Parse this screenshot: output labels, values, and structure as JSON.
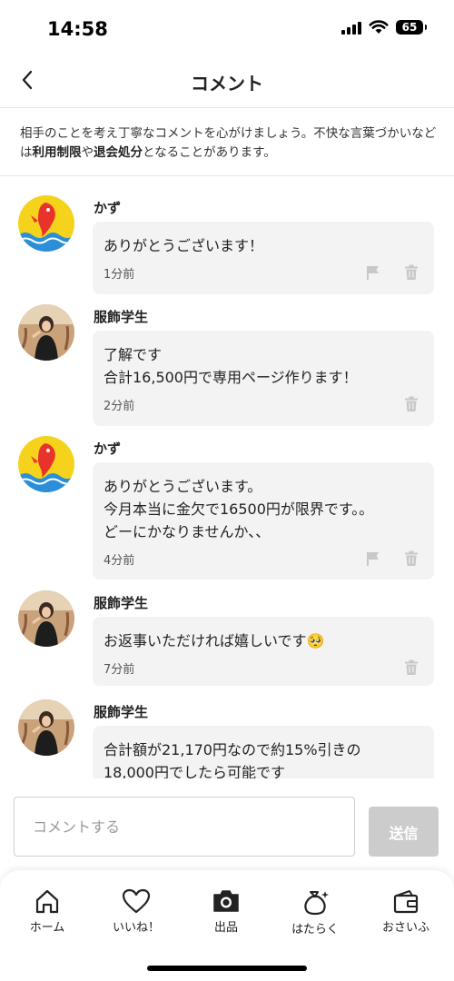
{
  "status_bar": {
    "time": "14:58",
    "battery": "65"
  },
  "header": {
    "title": "コメント"
  },
  "notice": {
    "part1": "相手のことを考え丁寧なコメントを心がけましょう。不快な言葉づかいなどは",
    "bold1": "利用制限",
    "part2": "や",
    "bold2": "退会処分",
    "part3": "となることがあります。"
  },
  "comments": [
    {
      "author": "かず",
      "text": "ありがとうございます！",
      "time": "1分前",
      "reportable": true
    },
    {
      "author": "服飾学生",
      "text": "了解です\n合計16,500円で専用ページ作ります！",
      "time": "2分前",
      "reportable": false
    },
    {
      "author": "かず",
      "text": "ありがとうございます。\n今月本当に金欠で16500円が限界です。。\nどーにかなりませんか、、",
      "time": "4分前",
      "reportable": true
    },
    {
      "author": "服飾学生",
      "text": "お返事いただければ嬉しいです🥺",
      "time": "7分前",
      "reportable": false
    },
    {
      "author": "服飾学生",
      "text": "合計額が21,170円なので約15%引きの\n18,000円でしたら可能です",
      "time": "",
      "reportable": false
    }
  ],
  "input": {
    "placeholder": "コメントする",
    "value": ""
  },
  "send_button": {
    "label": "送信"
  },
  "tabs": [
    {
      "label": "ホーム",
      "icon": "home-icon"
    },
    {
      "label": "いいね！",
      "icon": "heart-icon"
    },
    {
      "label": "出品",
      "icon": "camera-icon"
    },
    {
      "label": "はたらく",
      "icon": "money-bag-icon"
    },
    {
      "label": "おさいふ",
      "icon": "wallet-icon"
    }
  ],
  "colors": {
    "bubble_bg": "#f3f3f3",
    "send_disabled": "#cccccc",
    "avatar_yellow": "#f5d31c",
    "avatar_red": "#e8322a"
  }
}
